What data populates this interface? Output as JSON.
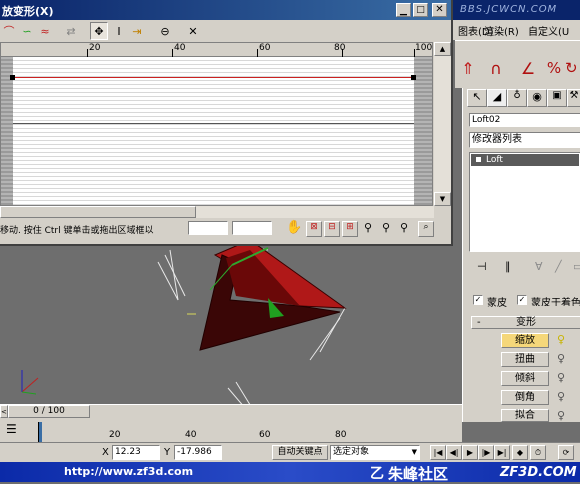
{
  "dialog": {
    "title": "放变形(X)",
    "ruler_ticks": [
      "20",
      "40",
      "60",
      "80",
      "100"
    ],
    "status_text": "移动. 按住 Ctrl 键单击或拖出区域框以",
    "field1_value": "",
    "field2_value": ""
  },
  "main_menu": {
    "watermark": "BBS.JCWCN.COM",
    "items": [
      "图表(D)",
      "渲染(R)",
      "自定义(U"
    ]
  },
  "command_panel": {
    "object_name": "Loft02",
    "modifier_list_label": "修改器列表",
    "stack_item": "Loft",
    "checkbox_skin": "蒙皮",
    "checkbox_skin_shading": "蒙皮于着色视",
    "rollout_title": "变形",
    "deform_buttons": [
      "缩放",
      "扭曲",
      "倾斜",
      "倒角",
      "拟合"
    ]
  },
  "timeline": {
    "frame_counter": "0 / 100",
    "ticks": [
      "20",
      "40",
      "60",
      "80"
    ]
  },
  "status_bar": {
    "x_label": "X",
    "x_value": "12.23",
    "y_label": "Y",
    "y_value": "-17.986",
    "auto_key": "自动关键点",
    "selection_dropdown": "选定对象"
  },
  "footer": {
    "url": "http://www.zf3d.com",
    "brand_cn": "朱峰社区",
    "brand_en": "ZF3D.COM"
  },
  "colors": {
    "titlebar_blue": "#0a246a",
    "footer_blue": "#0b2aa8",
    "viewport_bg": "#6e6e6e",
    "curve_red": "#cc2222",
    "active_button_yellow": "#f5d77a"
  }
}
